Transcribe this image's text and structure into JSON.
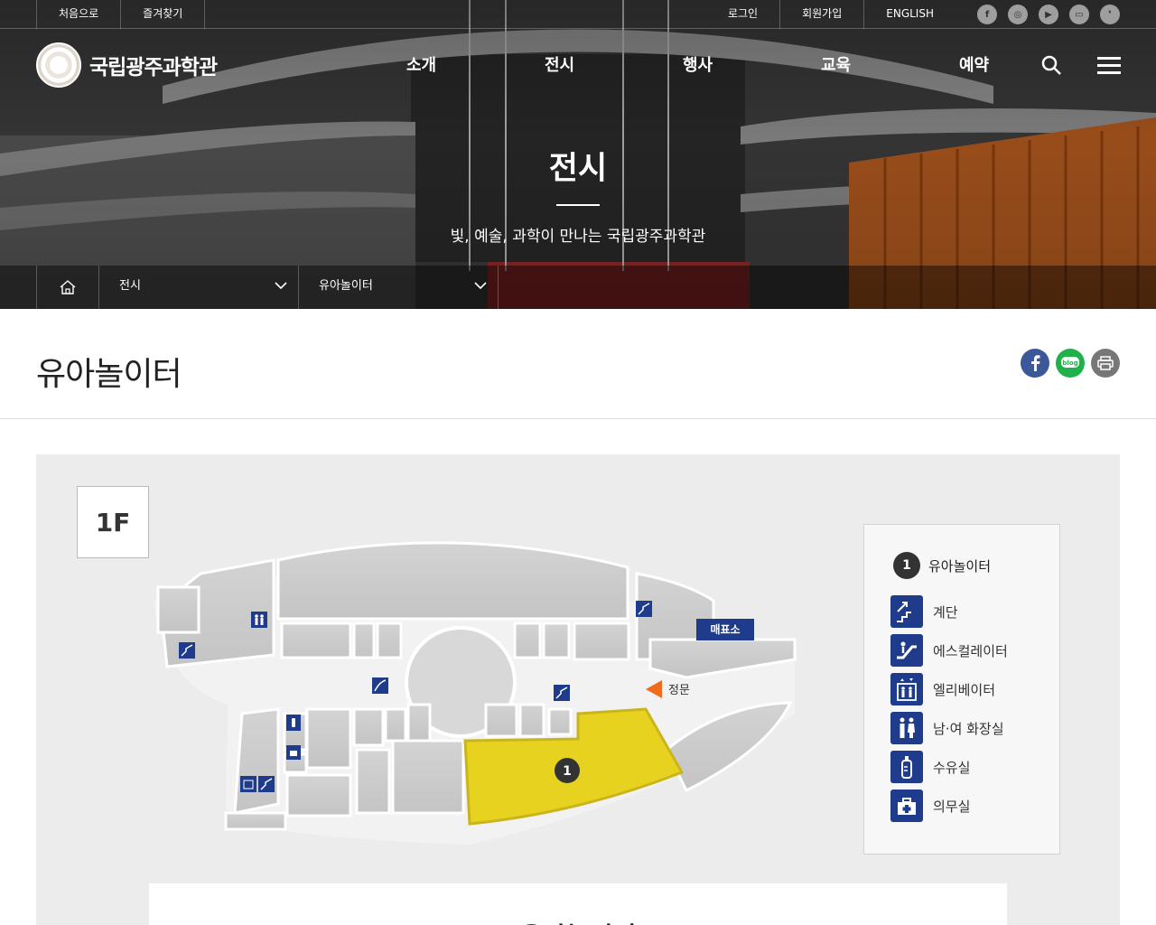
{
  "util_left": [
    "처음으로",
    "즐겨찾기"
  ],
  "util_right": [
    "로그인",
    "회원가입",
    "ENGLISH"
  ],
  "sns": [
    {
      "icon": "facebook-icon",
      "glyph": "f"
    },
    {
      "icon": "instagram-icon",
      "glyph": "◎"
    },
    {
      "icon": "youtube-icon",
      "glyph": "▶"
    },
    {
      "icon": "blog-icon",
      "glyph": "▭"
    },
    {
      "icon": "kakao-icon",
      "glyph": "❜"
    }
  ],
  "logo_text": "국립광주과학관",
  "gnb": [
    "소개",
    "전시",
    "행사",
    "교육",
    "예약"
  ],
  "hero": {
    "title": "전시",
    "subtitle": "빛, 예술, 과학이 만나는 국립광주과학관"
  },
  "breadcrumb": [
    "전시",
    "유아놀이터"
  ],
  "page_title": "유아놀이터",
  "floor": "1F",
  "map": {
    "ticket_label": "매표소",
    "gate_label": "정문",
    "zone_number": "1",
    "highlight_color": "#e8d220",
    "icon_color": "#1f3c8c"
  },
  "legend": {
    "main": {
      "number": "1",
      "label": "유아놀이터"
    },
    "items": [
      {
        "icon": "stairs-icon",
        "label": "계단"
      },
      {
        "icon": "escalator-icon",
        "label": "에스컬레이터"
      },
      {
        "icon": "elevator-icon",
        "label": "엘리베이터"
      },
      {
        "icon": "restroom-icon",
        "label": "남·여 화장실"
      },
      {
        "icon": "nursing-room-icon",
        "label": "수유실"
      },
      {
        "icon": "first-aid-icon",
        "label": "의무실"
      }
    ]
  },
  "info_title": "유아놀이터"
}
